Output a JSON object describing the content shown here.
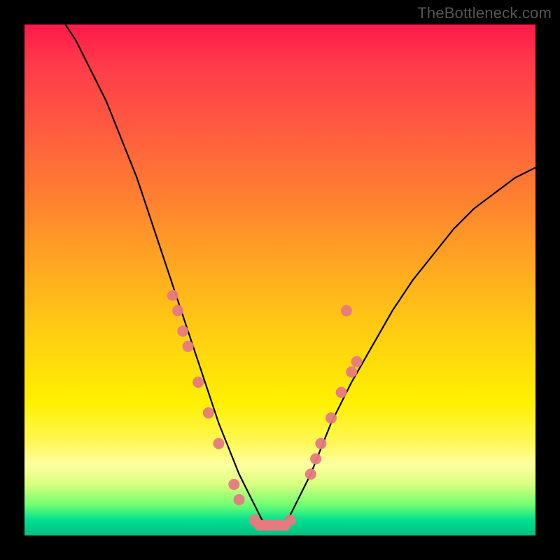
{
  "watermark": "TheBottleneck.com",
  "chart_data": {
    "type": "line",
    "title": "",
    "xlabel": "",
    "ylabel": "",
    "xlim": [
      0,
      100
    ],
    "ylim": [
      0,
      100
    ],
    "series": [
      {
        "name": "bottleneck-curve",
        "x": [
          8,
          10,
          12,
          14,
          16,
          18,
          20,
          22,
          24,
          26,
          28,
          30,
          32,
          34,
          36,
          38,
          40,
          42,
          44,
          46,
          47,
          48,
          50,
          52,
          54,
          56,
          58,
          60,
          64,
          68,
          72,
          76,
          80,
          84,
          88,
          92,
          96,
          100
        ],
        "y": [
          100,
          97,
          93,
          89,
          85,
          80,
          75,
          70,
          64,
          58,
          52,
          46,
          40,
          34,
          28,
          22,
          17,
          12,
          8,
          4,
          2,
          2,
          2,
          4,
          8,
          12,
          17,
          22,
          30,
          37,
          44,
          50,
          55,
          60,
          64,
          67,
          70,
          72
        ]
      }
    ],
    "markers": {
      "name": "highlighted-points",
      "color": "#e77a7f",
      "points": [
        {
          "x": 29,
          "y": 47
        },
        {
          "x": 30,
          "y": 44
        },
        {
          "x": 31,
          "y": 40
        },
        {
          "x": 32,
          "y": 37
        },
        {
          "x": 34,
          "y": 30
        },
        {
          "x": 36,
          "y": 24
        },
        {
          "x": 38,
          "y": 18
        },
        {
          "x": 41,
          "y": 10
        },
        {
          "x": 42,
          "y": 7
        },
        {
          "x": 45,
          "y": 3
        },
        {
          "x": 46,
          "y": 2
        },
        {
          "x": 47,
          "y": 2
        },
        {
          "x": 48,
          "y": 2
        },
        {
          "x": 49,
          "y": 2
        },
        {
          "x": 50,
          "y": 2
        },
        {
          "x": 51,
          "y": 2
        },
        {
          "x": 52,
          "y": 3
        },
        {
          "x": 56,
          "y": 12
        },
        {
          "x": 57,
          "y": 15
        },
        {
          "x": 58,
          "y": 18
        },
        {
          "x": 60,
          "y": 23
        },
        {
          "x": 62,
          "y": 28
        },
        {
          "x": 64,
          "y": 32
        },
        {
          "x": 65,
          "y": 34
        },
        {
          "x": 63,
          "y": 44
        }
      ]
    },
    "colors": {
      "curve": "#000000",
      "markers": "#e77a7f",
      "gradient_top": "#ff1a4a",
      "gradient_bottom": "#00c080"
    }
  }
}
